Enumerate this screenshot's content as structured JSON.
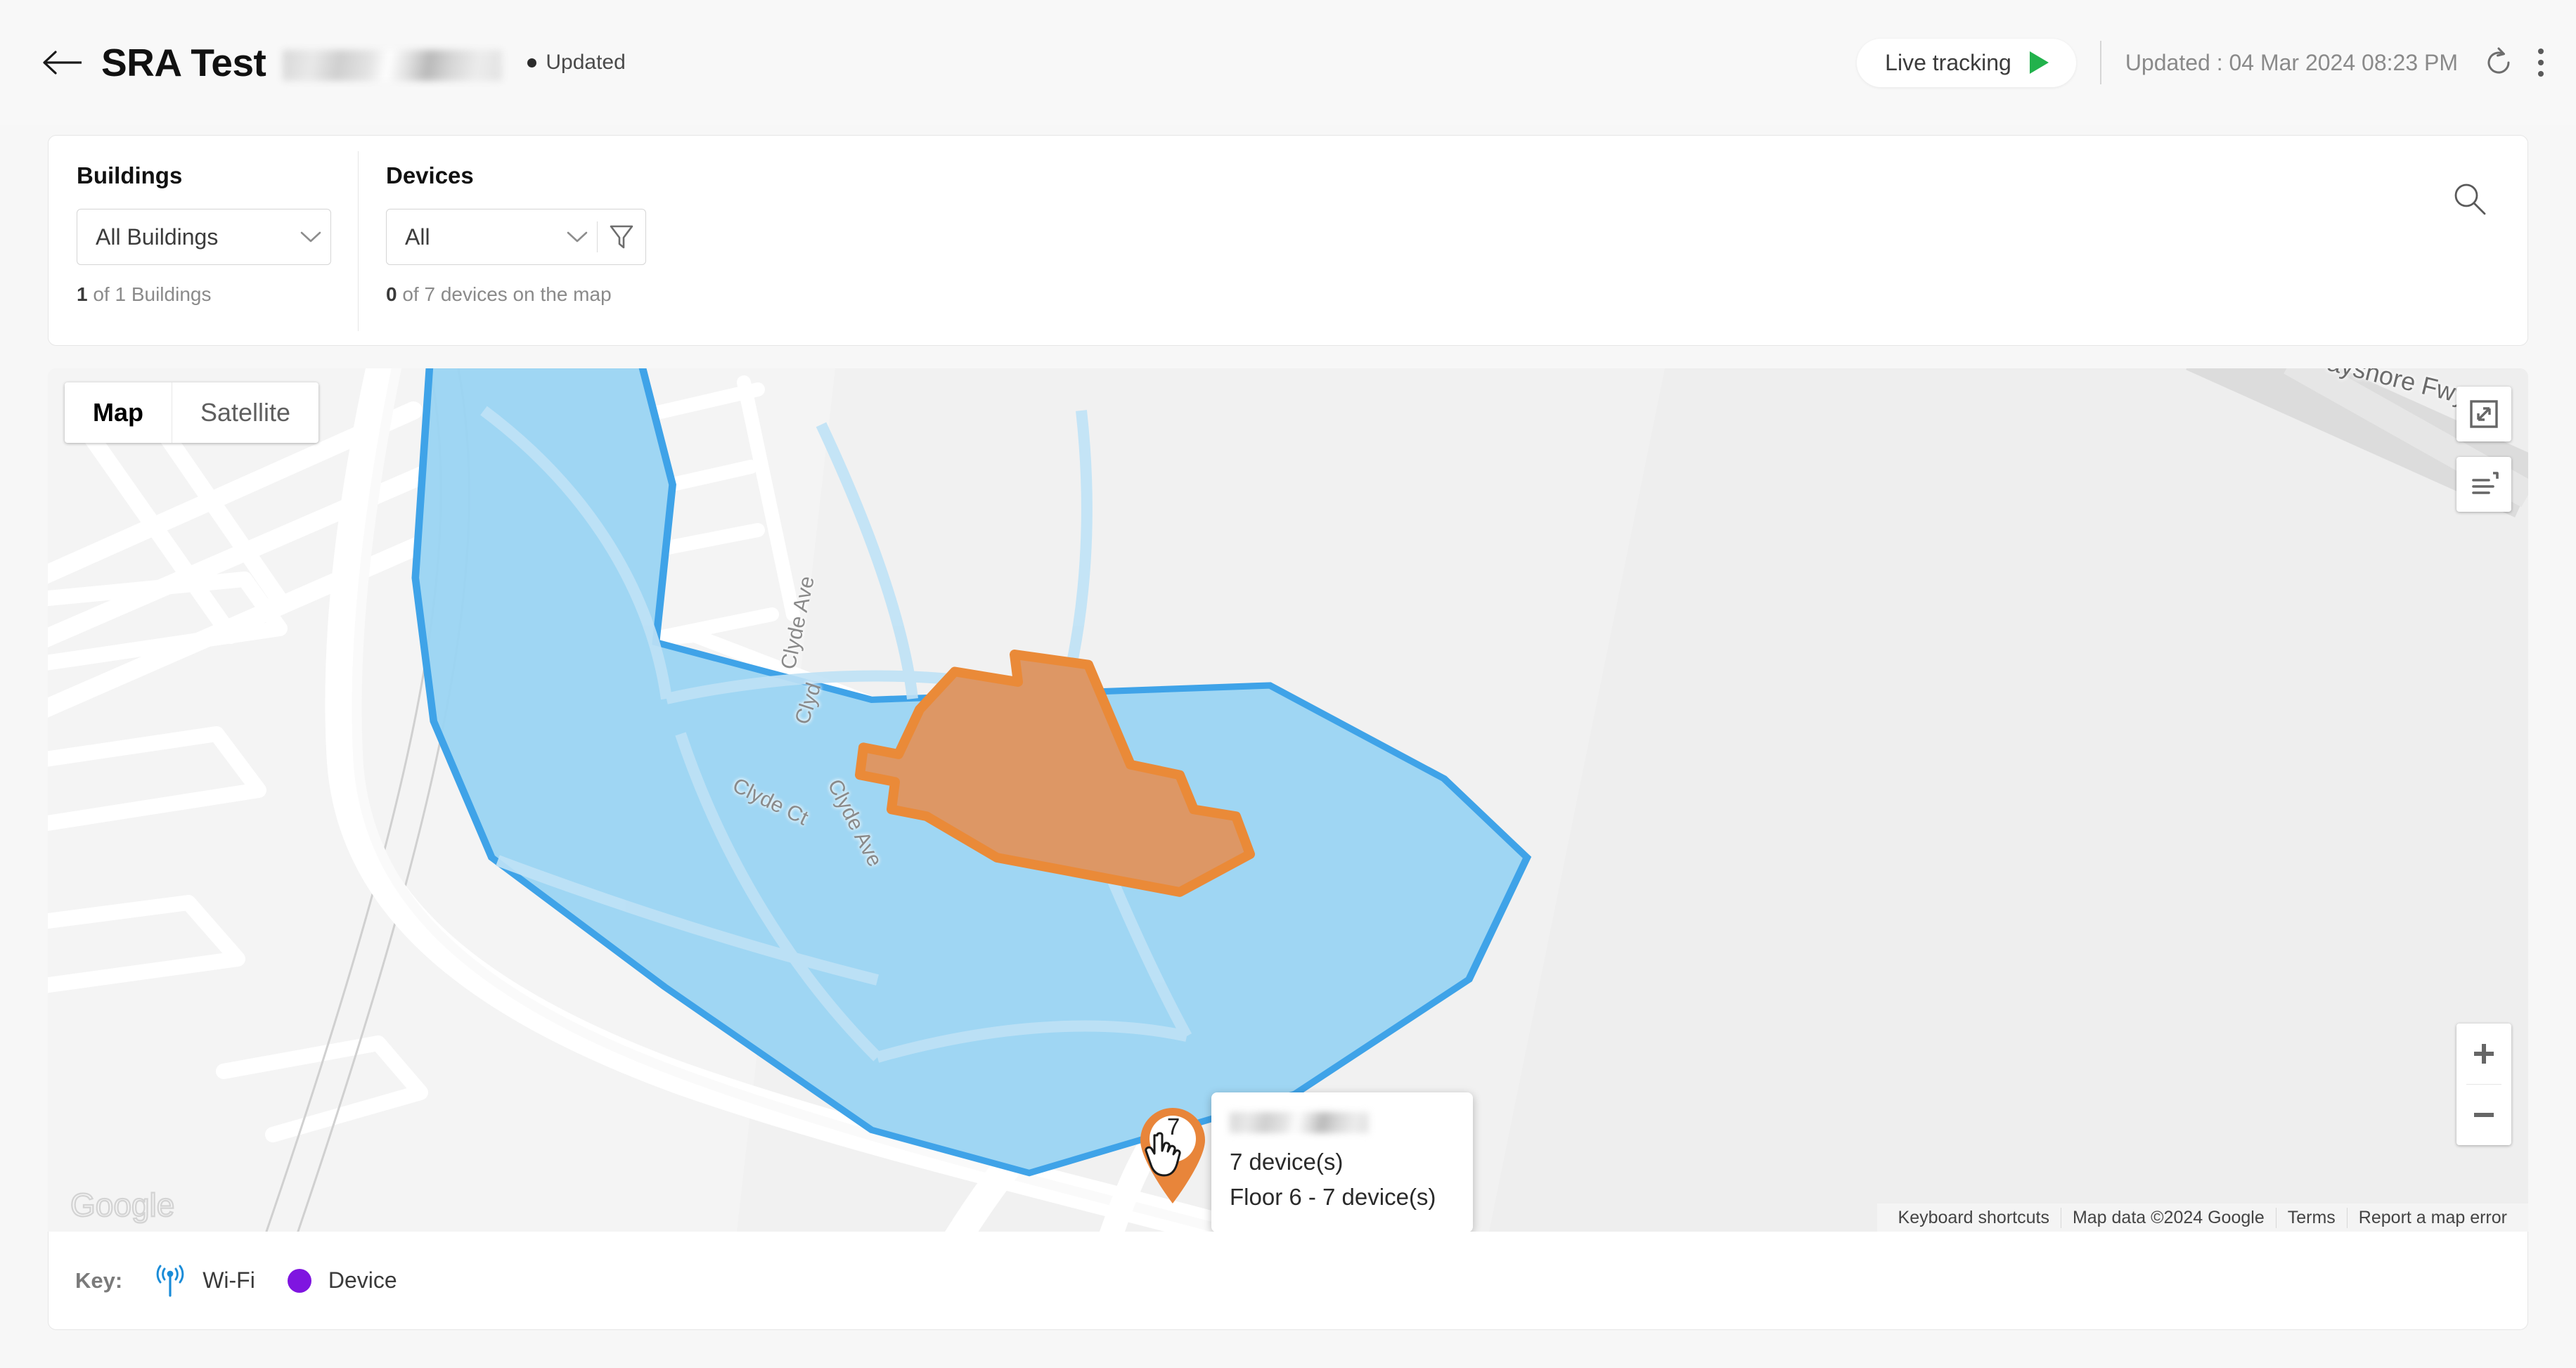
{
  "header": {
    "back_icon": "arrow-left-icon",
    "title": "SRA Test",
    "title_redacted": true,
    "status_label": "Updated",
    "live_tracking_label": "Live tracking",
    "live_tracking_icon": "play-icon",
    "last_updated": "Updated : 04 Mar 2024 08:23 PM",
    "refresh_icon": "refresh-icon",
    "more_icon": "kebab-menu-icon"
  },
  "filters": {
    "buildings": {
      "label": "Buildings",
      "selected": "All Buildings",
      "chevron_icon": "chevron-down-icon",
      "count_number": "1",
      "count_suffix": " of 1 Buildings"
    },
    "devices": {
      "label": "Devices",
      "selected": "All",
      "chevron_icon": "chevron-down-icon",
      "filter_icon": "funnel-filter-icon",
      "count_number": "0",
      "count_suffix": " of 7 devices on the map"
    },
    "search_icon": "search-icon"
  },
  "map": {
    "type_map_label": "Map",
    "type_satellite_label": "Satellite",
    "active_type": "Map",
    "fullscreen_icon": "expand-fullscreen-icon",
    "legend_icon": "map-legend-icon",
    "zoom_in_label": "+",
    "zoom_out_label": "−",
    "watermark": "Google",
    "attribution": [
      "Keyboard shortcuts",
      "Map data ©2024 Google",
      "Terms",
      "Report a map error"
    ],
    "street_labels": [
      "Clyde Ave",
      "Clyde Ave",
      "Clyde Ct",
      "Clyde Ave",
      "Clyd"
    ],
    "highway_label": "ayshore Fwy",
    "site_boundary_color": "#3FA3E8",
    "site_boundary_fill": "#9AD4F2",
    "building_color": "#E8853A",
    "marker": {
      "count": "7",
      "color": "#E8853A"
    },
    "info_window": {
      "title_redacted": true,
      "devices_line": "7 device(s)",
      "floor_line": "Floor 6 - 7 device(s)"
    }
  },
  "key": {
    "label": "Key:",
    "items": [
      {
        "label": "Wi-Fi",
        "icon": "wifi-antenna-icon",
        "color": "#1A8CD8"
      },
      {
        "label": "Device",
        "icon": "device-dot-icon",
        "color": "#7F15E0"
      }
    ]
  }
}
